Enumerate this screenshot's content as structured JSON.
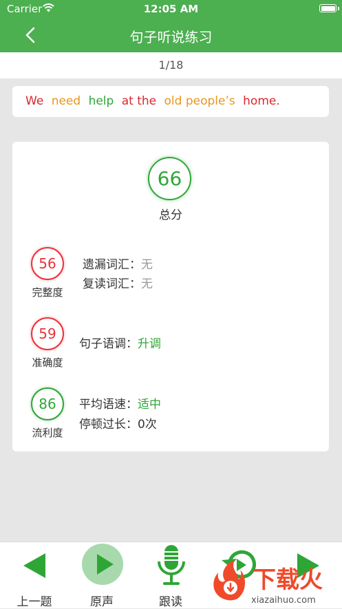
{
  "status_bar": {
    "carrier": "Carrier",
    "time": "12:05 AM"
  },
  "nav": {
    "title": "句子听说练习"
  },
  "progress": {
    "text": "1/18"
  },
  "sentence": {
    "words": [
      {
        "text": "We",
        "color": "#d9262e"
      },
      {
        "text": "need",
        "color": "#e8961e"
      },
      {
        "text": "help",
        "color": "#2ea636"
      },
      {
        "text": "at the",
        "color": "#d9262e"
      },
      {
        "text": "old people’s",
        "color": "#e8961e"
      },
      {
        "text": "home.",
        "color": "#d9262e"
      }
    ]
  },
  "scores": {
    "total": {
      "value": "66",
      "label": "总分"
    },
    "completeness": {
      "value": "56",
      "label": "完整度",
      "missing_label": "遗漏词汇：",
      "missing_value": "无",
      "repeat_label": "复读词汇：",
      "repeat_value": "无"
    },
    "accuracy": {
      "value": "59",
      "label": "准确度",
      "intonation_label": "句子语调：",
      "intonation_value": "升调"
    },
    "fluency": {
      "value": "86",
      "label": "流利度",
      "speed_label": "平均语速：",
      "speed_value": "适中",
      "pause_label": "停顿过长：",
      "pause_value": "0次"
    }
  },
  "toolbar": {
    "prev_label": "上一题",
    "original_label": "原声",
    "follow_label": "跟读"
  },
  "watermark": {
    "text": "下载火",
    "url_text": "xiazaihuo.com"
  },
  "colors": {
    "primary": "#4caf50",
    "score_green": "#2ea636",
    "score_red": "#e8323a"
  }
}
